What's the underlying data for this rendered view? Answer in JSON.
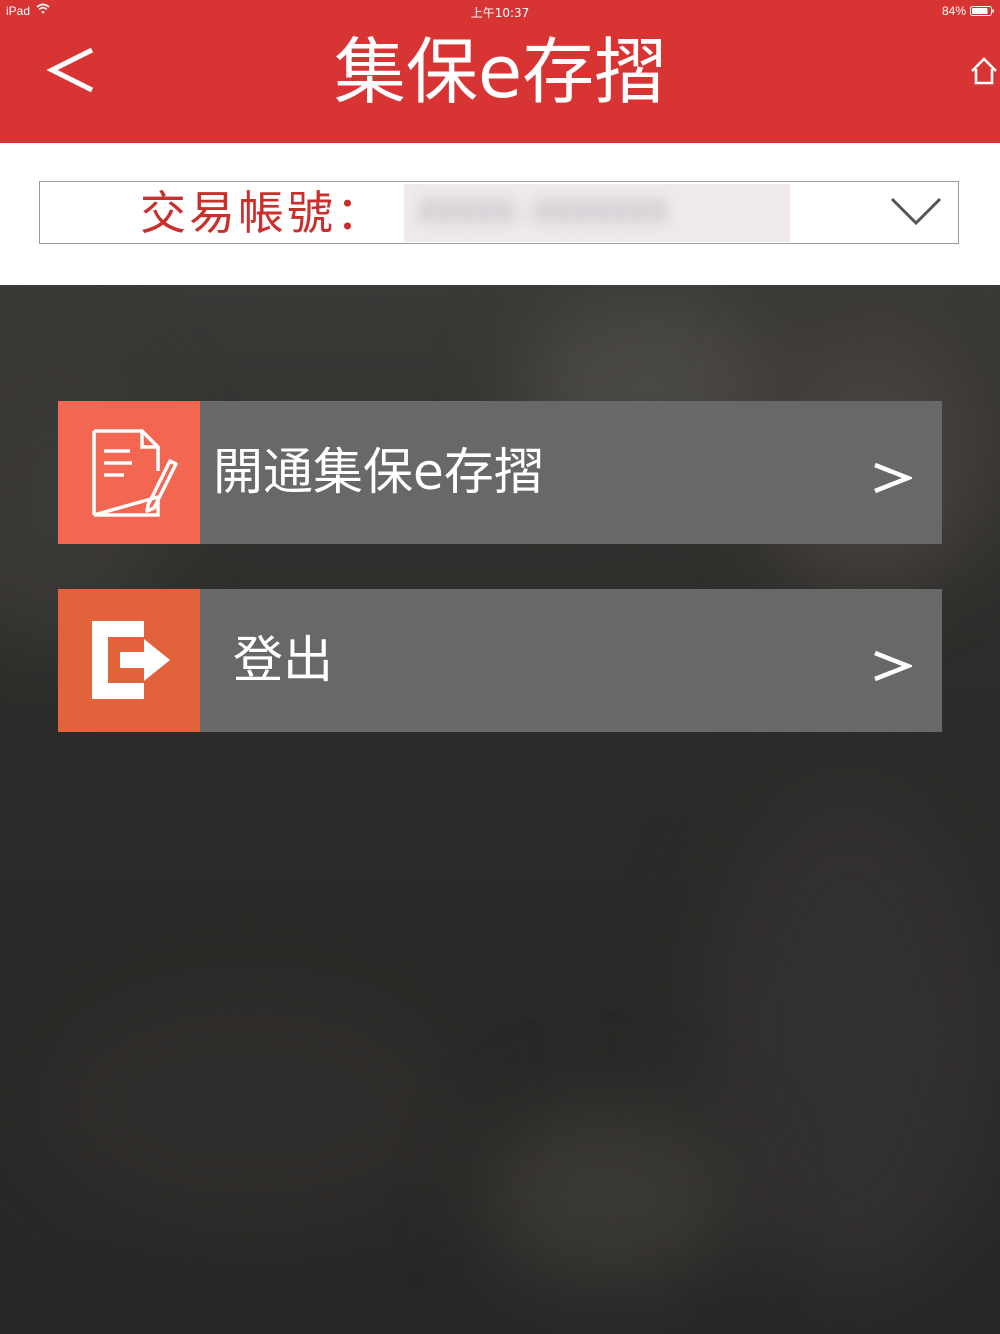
{
  "status_bar": {
    "device": "iPad",
    "time": "上午10:37",
    "battery": "84%",
    "icons": [
      "wifi-icon",
      "battery-icon"
    ]
  },
  "nav": {
    "title": "集保e存摺",
    "back_icon": "back-chevron-icon",
    "home_icon": "home-icon"
  },
  "account": {
    "label": "交易帳號：",
    "value_masked": "XXXXX-XXXXXXX",
    "dropdown_icon": "chevron-down-icon"
  },
  "menu": {
    "items": [
      {
        "label": "開通集保e存摺",
        "icon": "document-edit-icon",
        "arrow": ">",
        "icon_color": "#f26652"
      },
      {
        "label": "登出",
        "icon": "logout-icon",
        "arrow": ">",
        "icon_color": "#e2623b"
      }
    ]
  },
  "colors": {
    "header": "#d93434",
    "account_label": "#c9302c",
    "row_background": "#686868"
  }
}
